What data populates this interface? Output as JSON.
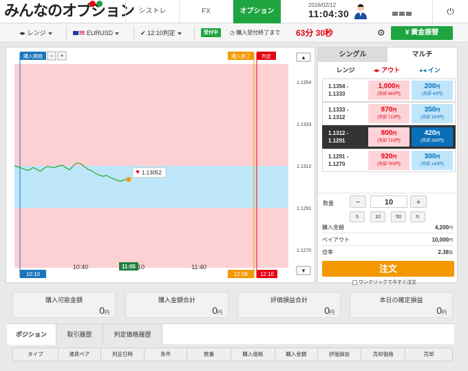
{
  "header": {
    "logo": "みんなのオプション",
    "nav": [
      "シストレ",
      "FX",
      "オプション"
    ],
    "active_nav": 2,
    "date": "2016/02/12",
    "time": "11:04:30",
    "power_icon": "power-icon"
  },
  "toolbar": {
    "type": "レンジ",
    "pair": "EURUSD",
    "judge": "12:10判定",
    "status": "受付中",
    "close_label": "購入受付終了まで",
    "countdown": "63分 30秒",
    "fund_button": "¥ 資金振替"
  },
  "chart": {
    "marker_buy_start": "購入開始",
    "marker_buy_end": "購入終了",
    "marker_judge": "判定",
    "current_rate": "1.13052",
    "time_labels": [
      "10:40",
      "11:05",
      "10",
      "11:40"
    ],
    "bottom_labels": [
      "10:10",
      "12:08",
      "12:10"
    ],
    "colors": {
      "out": "#fdd0d3",
      "in": "#bde6f8",
      "line": "#27a52b",
      "marker_start": "#1a75bc",
      "marker_end": "#f39800",
      "marker_judge": "#e60012"
    }
  },
  "chart_data": {
    "type": "line",
    "y_ticks": [
      1.1354,
      1.1333,
      1.1312,
      1.1291,
      1.127
    ],
    "ylim": [
      1.1261,
      1.1363
    ],
    "bands": [
      {
        "name": "out",
        "from": 1.1312,
        "to": 1.1363
      },
      {
        "name": "in",
        "from": 1.1291,
        "to": 1.1312
      },
      {
        "name": "out",
        "from": 1.1261,
        "to": 1.1291
      }
    ],
    "series": [
      {
        "values": [
          1.1312,
          1.13115,
          1.13108,
          1.131,
          1.13098,
          1.13112,
          1.13104,
          1.13092,
          1.13108,
          1.13118,
          1.13113,
          1.13112,
          1.1312,
          1.13123,
          1.1311,
          1.131,
          1.13122,
          1.13135,
          1.1313,
          1.13116,
          1.13102,
          1.13096,
          1.13082,
          1.13073,
          1.13068,
          1.13072,
          1.13062,
          1.13055,
          1.13046,
          1.13044,
          1.13052,
          1.13052
        ]
      }
    ]
  },
  "panel": {
    "tabs": [
      "シングル",
      "マルチ"
    ],
    "active_tab": 0,
    "col_range": "レンジ",
    "col_out": "アウト",
    "col_in": "イン",
    "ranges": [
      {
        "top": "1.1354 -",
        "bottom": "1.1333",
        "out": "1,000",
        "out_sell": "(売却 860円)",
        "in": "200",
        "in_sell": "(売却 40円)"
      },
      {
        "top": "1.1333 -",
        "bottom": "1.1312",
        "out": "870",
        "out_sell": "(売却 710円)",
        "in": "350",
        "in_sell": "(売却 190円)"
      },
      {
        "top": "1.1312 -",
        "bottom": "1.1291",
        "out": "800",
        "out_sell": "(売却 710円)",
        "in": "420",
        "in_sell": "(売却 260円)"
      },
      {
        "top": "1.1291 -",
        "bottom": "1.1270",
        "out": "920",
        "out_sell": "(売却 760円)",
        "in": "300",
        "in_sell": "(売却 140円)"
      }
    ],
    "selected_range": 2,
    "yen": "円",
    "qty_label": "数量",
    "qty": "10",
    "qty_minus": "−",
    "qty_plus": "+",
    "presets": [
      "5",
      "10",
      "50"
    ],
    "reset_icon": "↻",
    "amount_label": "購入金額",
    "amount": "4,200",
    "payout_label": "ペイアウト",
    "payout": "10,000",
    "ratio_label": "倍率",
    "ratio": "2.38",
    "ratio_unit": "倍",
    "order_button": "注文",
    "one_click": "ワンクリックで今すぐ注文"
  },
  "summary": [
    {
      "label": "購入可能金額",
      "value": "0"
    },
    {
      "label": "購入金額合計",
      "value": "0"
    },
    {
      "label": "評価損益合計",
      "value": "0"
    },
    {
      "label": "本日の確定損益",
      "value": "0"
    }
  ],
  "bottom_tabs": [
    "ポジション",
    "取引履歴",
    "判定価格履歴"
  ],
  "table_headers": [
    "タイプ",
    "通貨ペア",
    "判定日時",
    "条件",
    "数量",
    "購入価格",
    "購入金額",
    "評価損益",
    "売却価格",
    "売却"
  ]
}
